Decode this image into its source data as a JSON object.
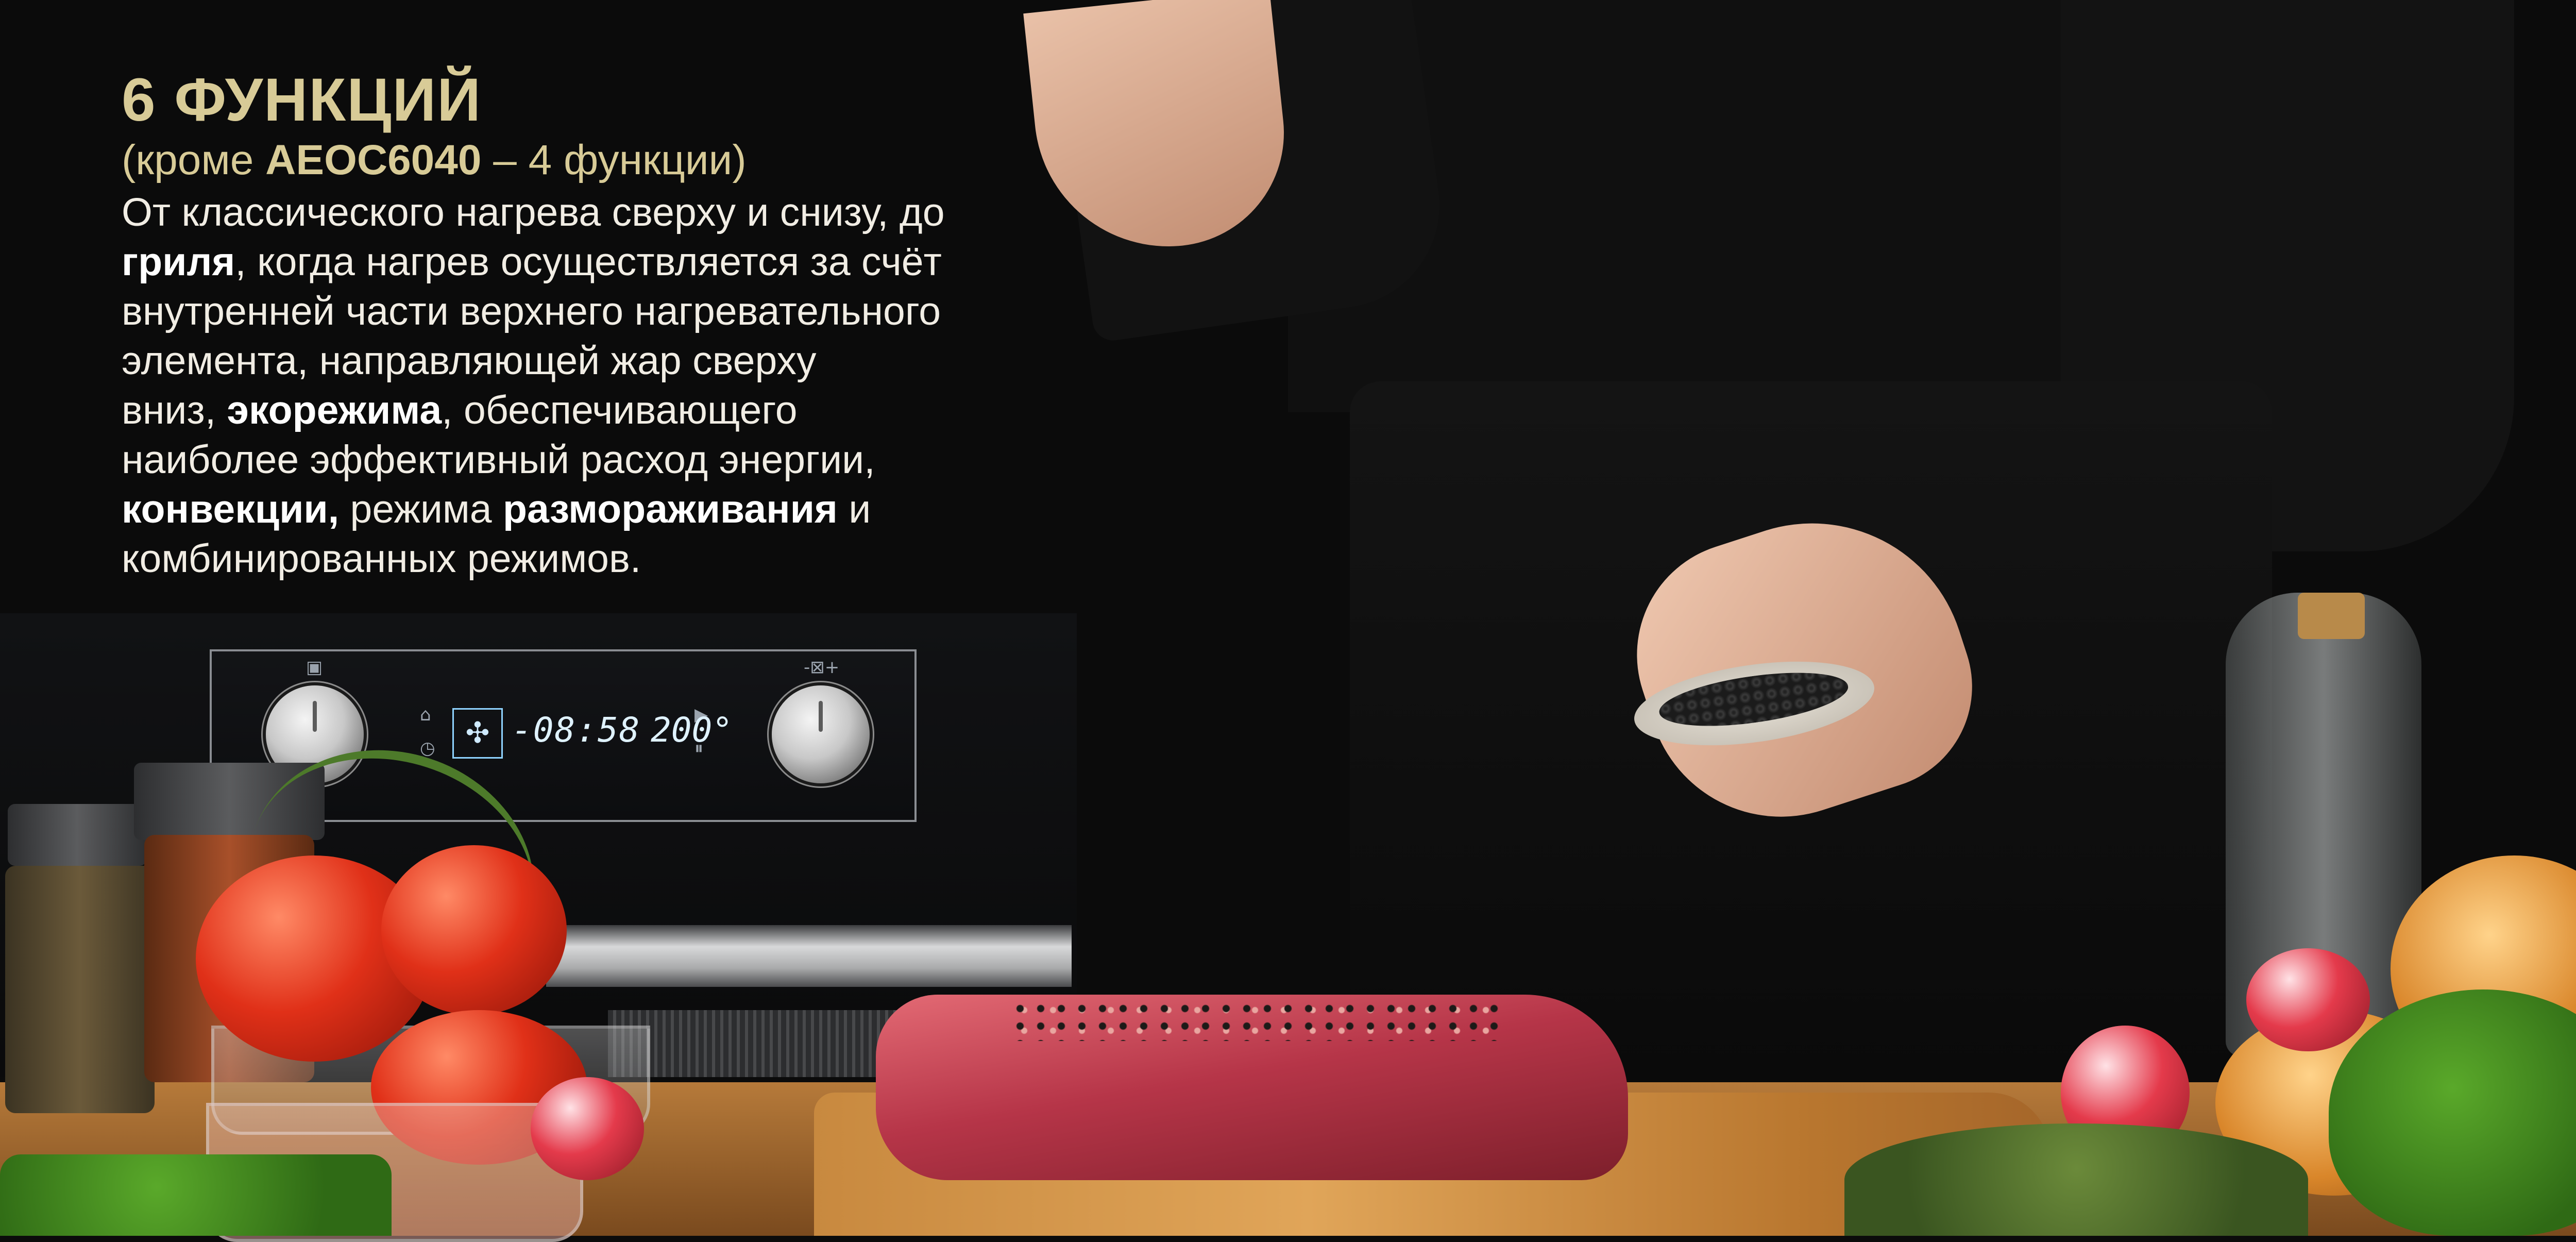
{
  "copy": {
    "title": "6 ФУНКЦИЙ",
    "subtitle_prefix": "(кроме ",
    "subtitle_model": "AEOC6040",
    "subtitle_suffix": " – 4 функции)",
    "lines": {
      "l1": "От классического нагрева сверху и снизу, до",
      "l2_bold": "гриля",
      "l2_rest": ", когда нагрев осуществляется за счёт",
      "l3": "внутренней части верхнего нагревательного",
      "l4": "элемента, направляющей жар сверху",
      "l5_a": "вниз, ",
      "l5_bold": "экорежима",
      "l5_rest": ", обеспечивающего",
      "l6": "наиболее эффективный расход энергии,",
      "l7_bold_a": "конвекции,",
      "l7_mid": " режима ",
      "l7_bold_b": "размораживания",
      "l7_end": " и",
      "l8": "комбинированных режимов."
    }
  },
  "oven": {
    "display_time": "-08:58",
    "display_temp": "200°",
    "fan_icon": "fan-icon"
  },
  "colors": {
    "accent_gold": "#d8cb97",
    "text_light": "#f1ede4",
    "background": "#0b0b0b"
  }
}
